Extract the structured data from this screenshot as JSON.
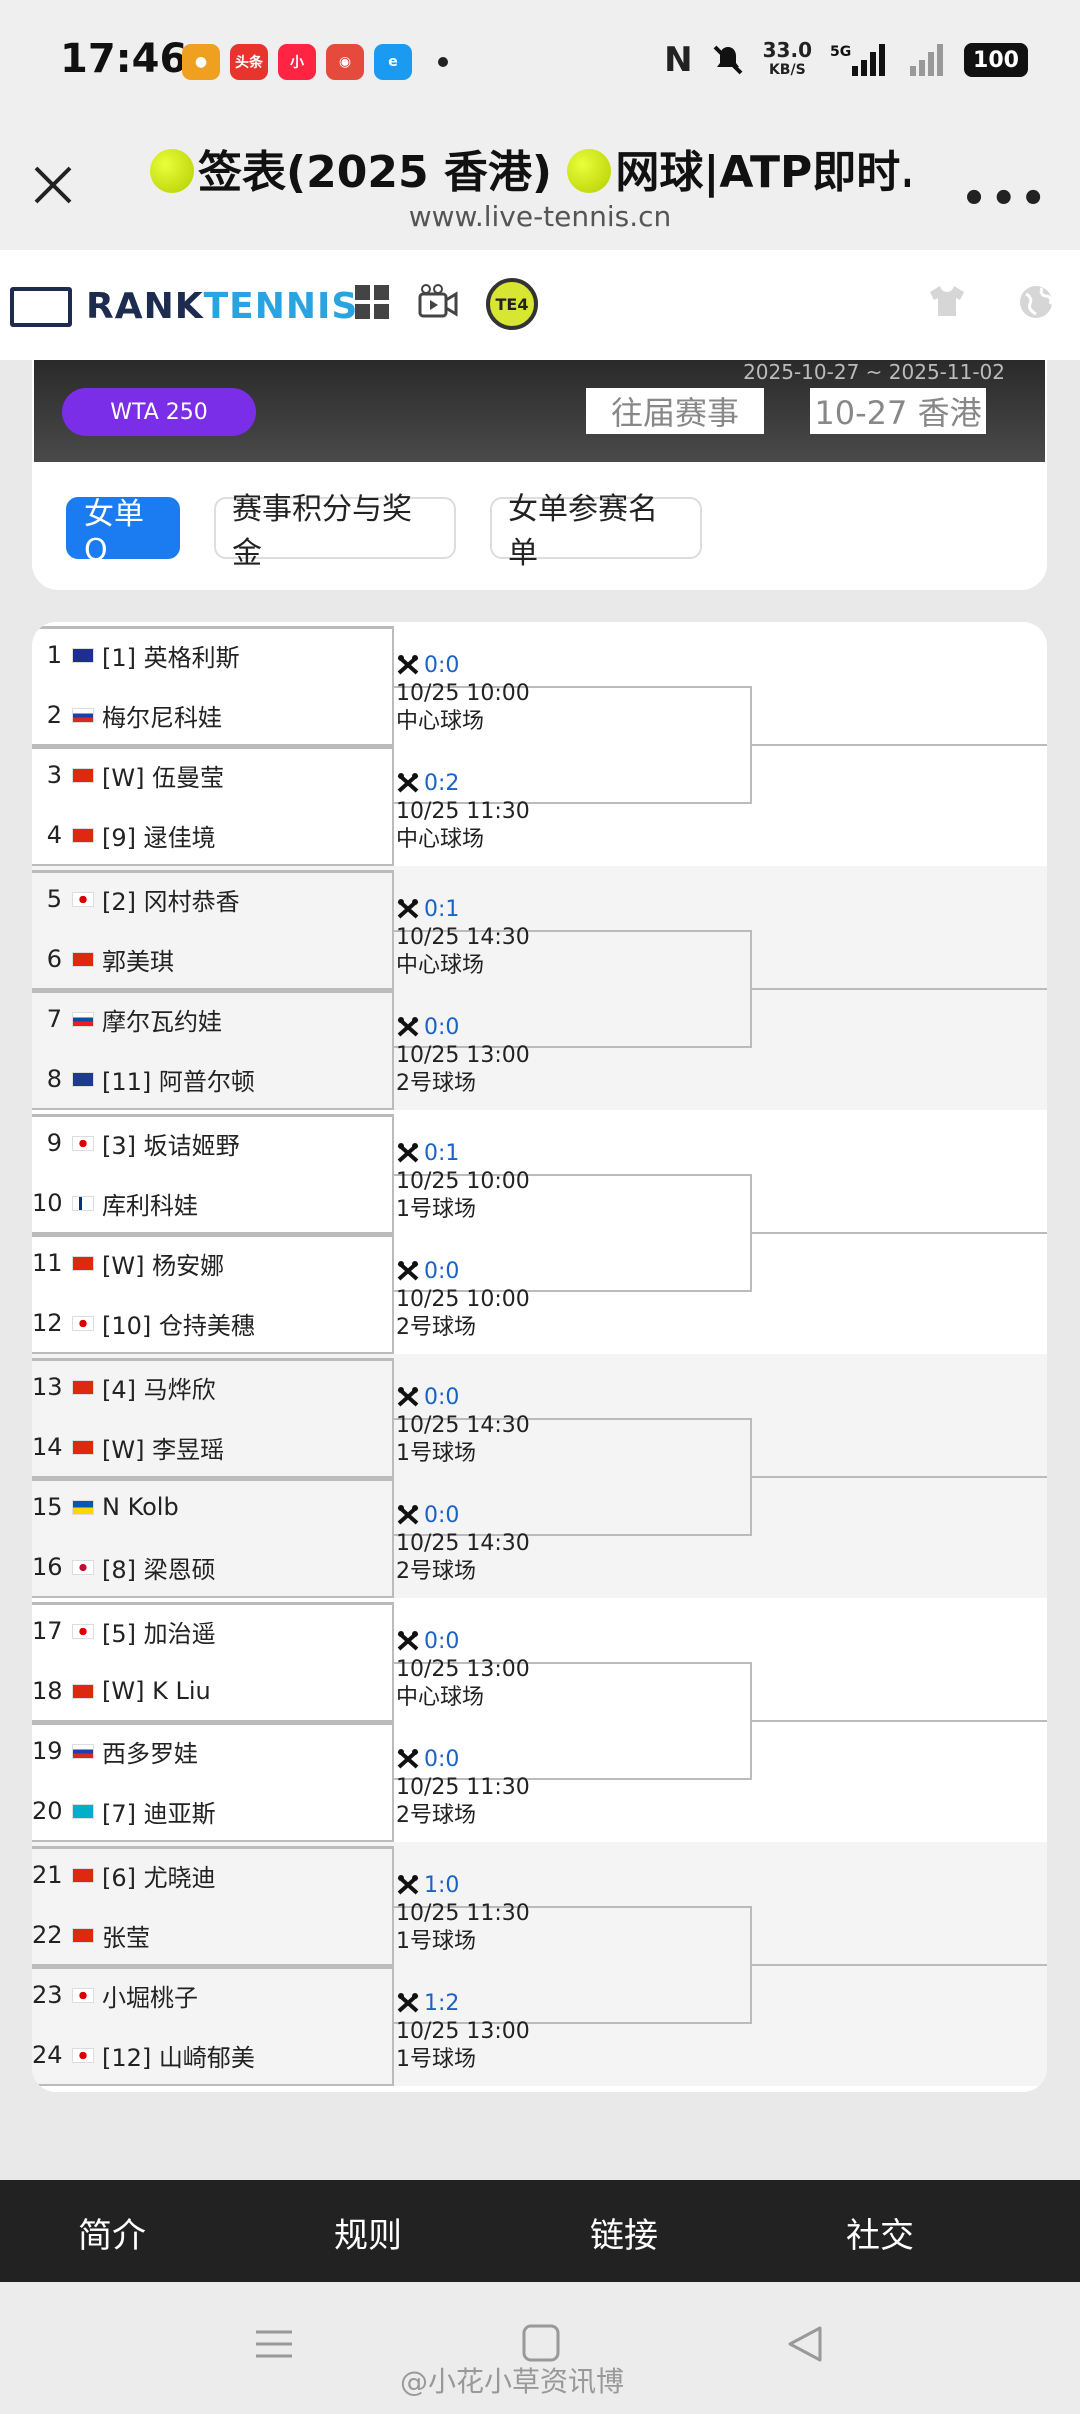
{
  "status_bar": {
    "time": "17:46",
    "apps": [
      "微博",
      "头条",
      "小红书",
      "百度",
      "饿了么"
    ],
    "net_speed": "33.0",
    "net_unit": "KB/S",
    "network": "5G",
    "battery": "100"
  },
  "title_bar": {
    "title": "签表(2025 香港)",
    "title2": "网球|ATP即时...",
    "url": "www.live-tennis.cn"
  },
  "site": {
    "logo_a": "RANK",
    "logo_b": "TENNIS",
    "te4": "TE4"
  },
  "banner": {
    "dates": "2025-10-27 ~ 2025-11-02",
    "level": "WTA 250",
    "past": "往届赛事",
    "event": "10-27 香港"
  },
  "tabs": [
    {
      "label": "女单Q"
    },
    {
      "label": "赛事积分与奖金"
    },
    {
      "label": "女单参赛名单"
    }
  ],
  "players": [
    {
      "num": "1",
      "name": "[1] 英格利斯",
      "flag": "au"
    },
    {
      "num": "2",
      "name": "梅尔尼科娃",
      "flag": "ru"
    },
    {
      "num": "3",
      "name": "[W] 伍曼莹",
      "flag": "hk"
    },
    {
      "num": "4",
      "name": "[9] 逯佳境",
      "flag": "cn"
    },
    {
      "num": "5",
      "name": "[2] 冈村恭香",
      "flag": "jp"
    },
    {
      "num": "6",
      "name": "郭美琪",
      "flag": "cn"
    },
    {
      "num": "7",
      "name": "摩尔瓦约娃",
      "flag": "sk"
    },
    {
      "num": "8",
      "name": "[11] 阿普尔顿",
      "flag": "gb"
    },
    {
      "num": "9",
      "name": "[3] 坂诘姬野",
      "flag": "jp"
    },
    {
      "num": "10",
      "name": "库利科娃",
      "flag": "fi"
    },
    {
      "num": "11",
      "name": "[W] 杨安娜",
      "flag": "cn"
    },
    {
      "num": "12",
      "name": "[10] 仓持美穗",
      "flag": "jp"
    },
    {
      "num": "13",
      "name": "[4] 马烨欣",
      "flag": "cn"
    },
    {
      "num": "14",
      "name": "[W] 李昱瑶",
      "flag": "cn"
    },
    {
      "num": "15",
      "name": "N Kolb",
      "flag": "ua"
    },
    {
      "num": "16",
      "name": "[8] 梁恩硕",
      "flag": "kr"
    },
    {
      "num": "17",
      "name": "[5] 加治遥",
      "flag": "jp"
    },
    {
      "num": "18",
      "name": "[W] K Liu",
      "flag": "hk"
    },
    {
      "num": "19",
      "name": "西多罗娃",
      "flag": "ru"
    },
    {
      "num": "20",
      "name": "[7] 迪亚斯",
      "flag": "kz"
    },
    {
      "num": "21",
      "name": "[6] 尤晓迪",
      "flag": "cn"
    },
    {
      "num": "22",
      "name": "张莹",
      "flag": "cn"
    },
    {
      "num": "23",
      "name": "小堀桃子",
      "flag": "jp"
    },
    {
      "num": "24",
      "name": "[12] 山崎郁美",
      "flag": "jp"
    }
  ],
  "matches": [
    {
      "score": "0:0",
      "time": "10/25 10:00",
      "court": "中心球场"
    },
    {
      "score": "0:2",
      "time": "10/25 11:30",
      "court": "中心球场"
    },
    {
      "score": "0:1",
      "time": "10/25 14:30",
      "court": "中心球场"
    },
    {
      "score": "0:0",
      "time": "10/25 13:00",
      "court": "2号球场"
    },
    {
      "score": "0:1",
      "time": "10/25 10:00",
      "court": "1号球场"
    },
    {
      "score": "0:0",
      "time": "10/25 10:00",
      "court": "2号球场"
    },
    {
      "score": "0:0",
      "time": "10/25 14:30",
      "court": "1号球场"
    },
    {
      "score": "0:0",
      "time": "10/25 14:30",
      "court": "2号球场"
    },
    {
      "score": "0:0",
      "time": "10/25 13:00",
      "court": "中心球场"
    },
    {
      "score": "0:0",
      "time": "10/25 11:30",
      "court": "2号球场"
    },
    {
      "score": "1:0",
      "time": "10/25 11:30",
      "court": "1号球场"
    },
    {
      "score": "1:2",
      "time": "10/25 13:00",
      "court": "1号球场"
    }
  ],
  "footer": {
    "items": [
      "简介",
      "规则",
      "链接",
      "社交"
    ]
  },
  "watermark": "@小花小草资讯博",
  "colors": {
    "accent": "#1a7cf0",
    "wta": "#7a2ee8",
    "score": "#1a62c5"
  }
}
